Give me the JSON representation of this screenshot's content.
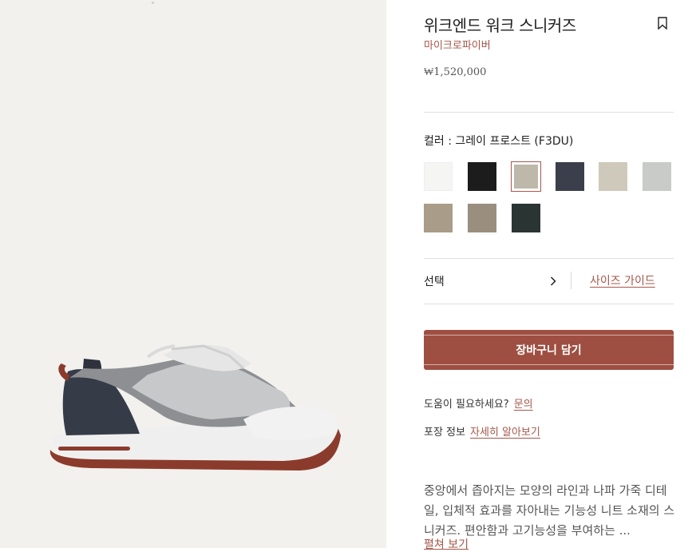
{
  "product": {
    "title": "위크엔드 워크 스니커즈",
    "material": "마이크로파이버",
    "price": "₩1,520,000",
    "color_label": "컬러 : 그레이 프로스트 (F3DU)",
    "icons": {
      "bookmark": "bookmark-icon",
      "chevron": "chevron-right-icon"
    }
  },
  "swatches": [
    {
      "name": "white",
      "color": "#f5f5f3"
    },
    {
      "name": "black",
      "color": "#1c1c1c"
    },
    {
      "name": "grey-frost",
      "color": "#bdb8aa",
      "selected": true
    },
    {
      "name": "navy",
      "color": "#3b3e4b"
    },
    {
      "name": "beige",
      "color": "#cfc9bb"
    },
    {
      "name": "light-grey",
      "color": "#c9cbc8"
    },
    {
      "name": "brown-beige",
      "color": "#a99d89"
    },
    {
      "name": "taupe",
      "color": "#9a8f7f"
    },
    {
      "name": "dark-green",
      "color": "#2a3433"
    }
  ],
  "size": {
    "select_label": "선택",
    "guide_link": "사이즈 가이드"
  },
  "cart": {
    "button_label": "장바구니 담기"
  },
  "help": {
    "question": "도움이 필요하세요?",
    "link": "문의"
  },
  "packaging": {
    "label": "포장 정보",
    "link": "자세히 알아보기"
  },
  "description": {
    "text": "중앙에서 좁아지는 모양의 라인과 나파 가죽 디테일, 입체적 효과를 자아내는 기능성 니트 소재의 스니커즈. 편안함과 고기능성을 부여하는 ...",
    "expand": "펼쳐 보기"
  },
  "colors": {
    "accent": "#9e4f41",
    "link": "#a5574a",
    "image_bg": "#f3f1ee"
  }
}
